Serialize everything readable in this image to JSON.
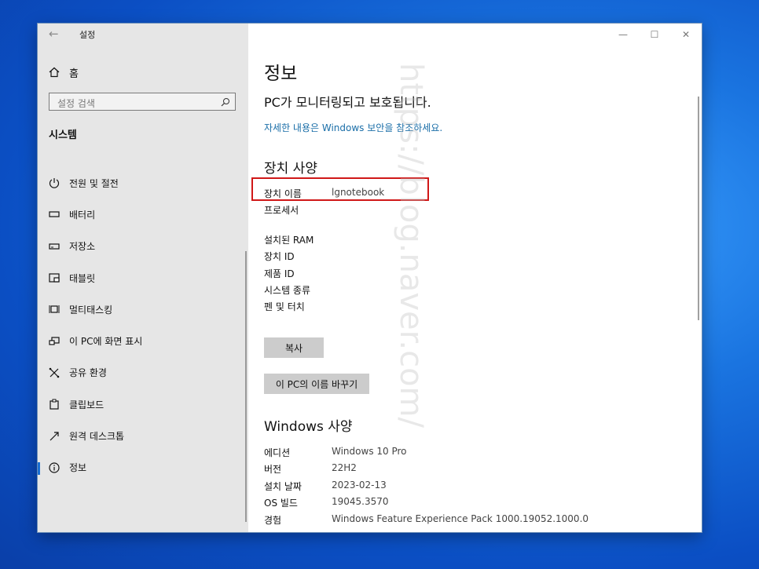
{
  "window": {
    "title": "설정",
    "back_glyph": "←",
    "controls": [
      "—",
      "☐",
      "✕"
    ]
  },
  "sidebar": {
    "home_label": "홈",
    "search_placeholder": "설정 검색",
    "section_title": "시스템",
    "items": [
      {
        "label": "전원 및 절전",
        "icon": "power-icon"
      },
      {
        "label": "배터리",
        "icon": "battery-icon"
      },
      {
        "label": "저장소",
        "icon": "storage-icon"
      },
      {
        "label": "태블릿",
        "icon": "tablet-icon"
      },
      {
        "label": "멀티태스킹",
        "icon": "multitasking-icon"
      },
      {
        "label": "이 PC에 화면 표시",
        "icon": "project-icon"
      },
      {
        "label": "공유 환경",
        "icon": "shared-experience-icon"
      },
      {
        "label": "클립보드",
        "icon": "clipboard-icon"
      },
      {
        "label": "원격 데스크톱",
        "icon": "remote-desktop-icon"
      },
      {
        "label": "정보",
        "icon": "info-icon",
        "active": true
      }
    ]
  },
  "main": {
    "title": "정보",
    "protected_text": "PC가 모니터링되고 보호됩니다.",
    "security_link": "자세한 내용은 Windows 보안을 참조하세요.",
    "device_specs": {
      "heading": "장치 사양",
      "rows": [
        {
          "key": "장치 이름",
          "value": "lgnotebook"
        },
        {
          "key": "프로세서",
          "value": ""
        },
        {
          "key": "설치된 RAM",
          "value": ""
        },
        {
          "key": "장치 ID",
          "value": ""
        },
        {
          "key": "제품 ID",
          "value": ""
        },
        {
          "key": "시스템 종류",
          "value": ""
        },
        {
          "key": "펜 및 터치",
          "value": ""
        }
      ],
      "copy_button": "복사",
      "rename_button": "이 PC의 이름 바꾸기"
    },
    "windows_specs": {
      "heading": "Windows 사양",
      "rows": [
        {
          "key": "에디션",
          "value": "Windows 10 Pro"
        },
        {
          "key": "버전",
          "value": "22H2"
        },
        {
          "key": "설치 날짜",
          "value": "2023-02-13"
        },
        {
          "key": "OS 빌드",
          "value": "19045.3570"
        },
        {
          "key": "경험",
          "value": "Windows Feature Experience Pack 1000.19052.1000.0"
        }
      ]
    }
  },
  "watermark": "https://blog.naver.com/",
  "colors": {
    "accent": "#1a6fd4",
    "highlight": "#d01818",
    "link": "#1a6ea8"
  }
}
